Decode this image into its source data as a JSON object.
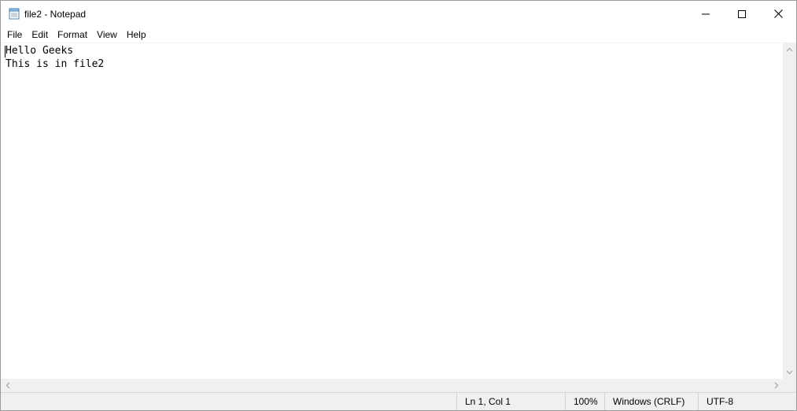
{
  "window": {
    "title": "file2 - Notepad"
  },
  "titlebar": {
    "app_icon": "notepad-icon",
    "minimize_icon": "minimize-icon",
    "maximize_icon": "maximize-icon",
    "close_icon": "close-icon"
  },
  "menu": {
    "items": [
      {
        "label": "File"
      },
      {
        "label": "Edit"
      },
      {
        "label": "Format"
      },
      {
        "label": "View"
      },
      {
        "label": "Help"
      }
    ]
  },
  "editor": {
    "lines": [
      "Hello Geeks",
      "This is in file2"
    ]
  },
  "statusbar": {
    "position": "Ln 1, Col 1",
    "zoom": "100%",
    "line_ending": "Windows (CRLF)",
    "encoding": "UTF-8"
  },
  "colors": {
    "chrome": "#f0f0f0",
    "background": "#ffffff",
    "text": "#000000"
  }
}
